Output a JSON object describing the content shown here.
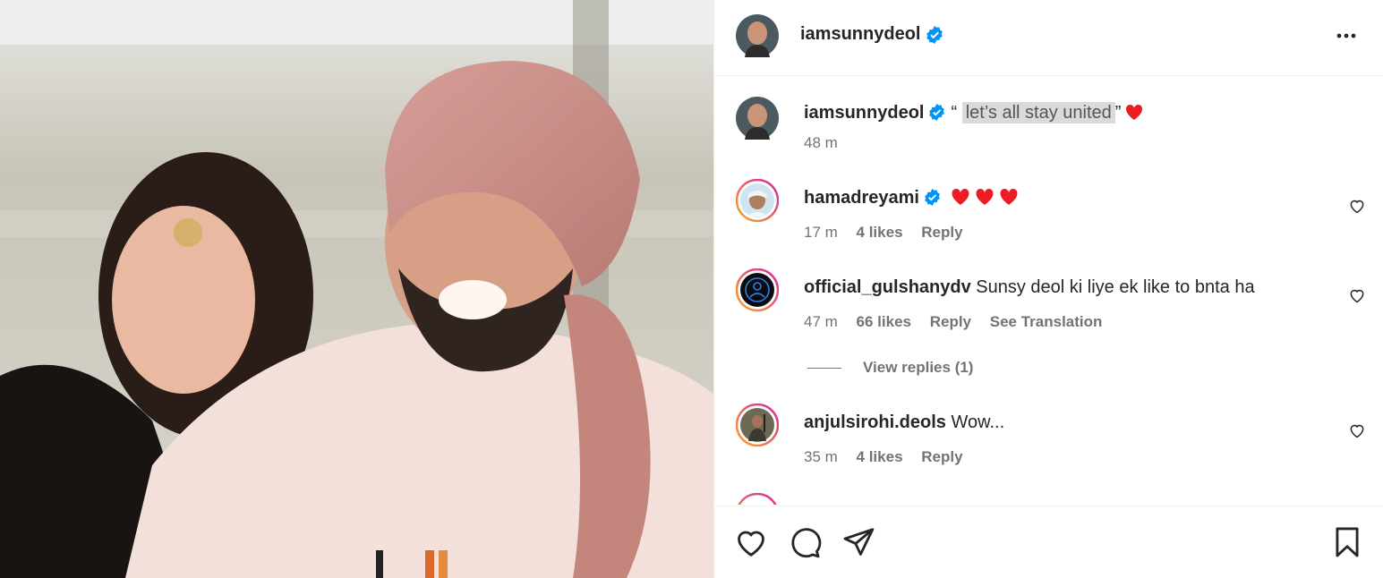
{
  "post": {
    "author": "iamsunnydeol",
    "caption": {
      "open_quote": "“",
      "text": "let’s all stay united",
      "close_quote": "”",
      "time": "48 m"
    }
  },
  "comments": [
    {
      "user": "hamadreyami",
      "verified": true,
      "text": "",
      "hearts": 3,
      "time": "17 m",
      "likes": "4 likes",
      "reply": "Reply"
    },
    {
      "user": "official_gulshanydv",
      "verified": false,
      "text": "Sunsy deol ki liye ek like to bnta ha",
      "hearts": 0,
      "time": "47 m",
      "likes": "66 likes",
      "reply": "Reply",
      "translation": "See Translation"
    },
    {
      "user": "anjulsirohi.deols",
      "verified": false,
      "text": "Wow...",
      "hearts": 0,
      "time": "35 m",
      "likes": "4 likes",
      "reply": "Reply"
    }
  ],
  "view_replies": "View replies (1)",
  "colors": {
    "verified": "#0095f6",
    "heart_red": "#ed1c24",
    "story_ring_start": "#f9a825",
    "story_ring_end": "#d6249f",
    "muted": "#737373",
    "text": "#262626"
  },
  "icons": {
    "more": "more-options-icon",
    "like": "heart-outline-icon",
    "comment": "comment-bubble-icon",
    "share": "paper-plane-icon",
    "save": "bookmark-icon"
  }
}
